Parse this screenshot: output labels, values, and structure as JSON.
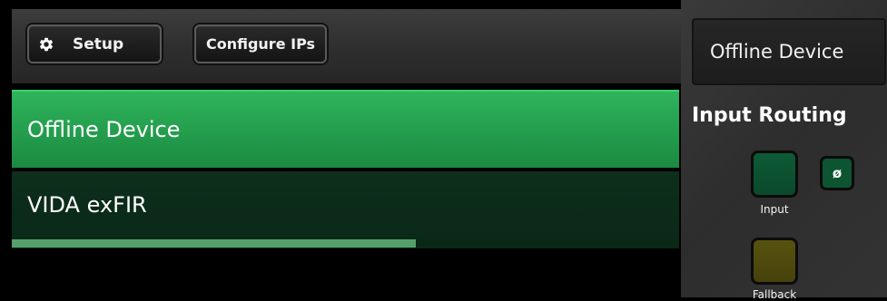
{
  "toolbar": {
    "setup_label": "Setup",
    "configure_label": "Configure IPs"
  },
  "devices": [
    {
      "name": "Offline Device",
      "selected": true
    },
    {
      "name": "VIDA exFIR",
      "selected": false,
      "progress_fraction": 0.605
    }
  ],
  "panel": {
    "device_select_value": "Offline Device",
    "routing_title": "Input Routing",
    "input_label": "Input",
    "phase_label": "ø",
    "fallback_label": "Fallback"
  },
  "colors": {
    "selected_row": "#25a14f",
    "unselected_row": "#0a2818",
    "progress": "#55a06a",
    "input_button": "#0a4a2c",
    "fallback_button": "#46420b"
  },
  "icons": {
    "setup": "gear-icon"
  }
}
